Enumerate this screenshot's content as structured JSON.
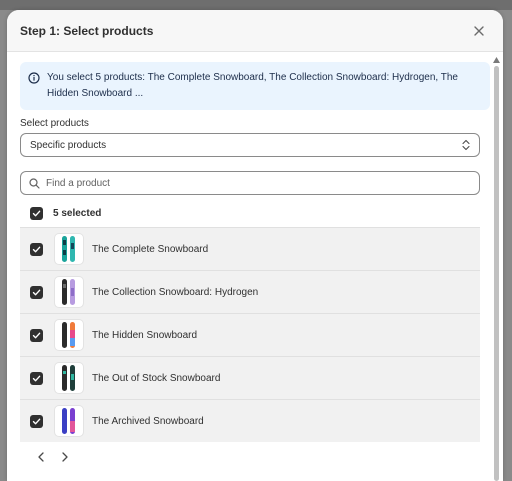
{
  "modal": {
    "title": "Step 1: Select products",
    "close_icon": "close-icon"
  },
  "banner": {
    "icon": "info-icon",
    "text": "You select 5 products: The Complete Snowboard, The Collection Snowboard: Hydrogen, The Hidden Snowboard ..."
  },
  "select_products": {
    "label": "Select products",
    "value": "Specific products",
    "icon": "select-chevron-icon"
  },
  "search": {
    "placeholder": "Find a product",
    "icon": "search-icon"
  },
  "list": {
    "selected_label": "5 selected",
    "rows": [
      {
        "label": "The Complete Snowboard",
        "checked": true
      },
      {
        "label": "The Collection Snowboard: Hydrogen",
        "checked": true
      },
      {
        "label": "The Hidden Snowboard",
        "checked": true
      },
      {
        "label": "The Out of Stock Snowboard",
        "checked": true
      },
      {
        "label": "The Archived Snowboard",
        "checked": true
      }
    ]
  },
  "pager": {
    "prev_icon": "chevron-left-icon",
    "next_icon": "chevron-right-icon"
  },
  "colors": {
    "banner_bg": "#eaf4fe",
    "checkbox": "#303030",
    "row_bg": "#f1f1f1"
  }
}
